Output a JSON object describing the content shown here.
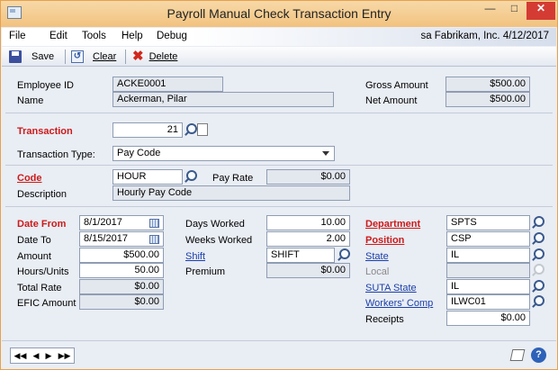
{
  "window": {
    "title": "Payroll Manual Check Transaction Entry"
  },
  "menu": {
    "items": [
      "File",
      "Edit",
      "Tools",
      "Help",
      "Debug"
    ],
    "company_info": "sa  Fabrikam, Inc.  4/12/2017"
  },
  "toolbar": {
    "save": "Save",
    "clear": "Clear",
    "delete": "Delete"
  },
  "employee": {
    "id_label": "Employee ID",
    "id_value": "ACKE0001",
    "name_label": "Name",
    "name_value": "Ackerman, Pilar"
  },
  "totals": {
    "gross_label": "Gross Amount",
    "gross_value": "$500.00",
    "net_label": "Net Amount",
    "net_value": "$500.00"
  },
  "transaction": {
    "label": "Transaction",
    "value": "21",
    "type_label": "Transaction Type:",
    "type_value": "Pay Code"
  },
  "code": {
    "label": "Code",
    "value": "HOUR",
    "pay_rate_label": "Pay Rate",
    "pay_rate_value": "$0.00",
    "description_label": "Description",
    "description_value": "Hourly Pay Code"
  },
  "left": {
    "date_from_label": "Date From",
    "date_from": "8/1/2017",
    "date_to_label": "Date To",
    "date_to": "8/15/2017",
    "amount_label": "Amount",
    "amount": "$500.00",
    "hours_label": "Hours/Units",
    "hours": "50.00",
    "total_rate_label": "Total Rate",
    "total_rate": "$0.00",
    "efic_label": "EFIC Amount",
    "efic": "$0.00"
  },
  "middle": {
    "days_label": "Days Worked",
    "days": "10.00",
    "weeks_label": "Weeks Worked",
    "weeks": "2.00",
    "shift_label": "Shift",
    "shift": "SHIFT",
    "premium_label": "Premium",
    "premium": "$0.00"
  },
  "right": {
    "department_label": "Department",
    "department": "SPTS",
    "position_label": "Position",
    "position": "CSP",
    "state_label": "State",
    "state": "IL",
    "local_label": "Local",
    "local": "",
    "suta_label": "SUTA State",
    "suta": "IL",
    "workers_comp_label": "Workers' Comp",
    "workers_comp": "ILWC01",
    "receipts_label": "Receipts",
    "receipts": "$0.00"
  },
  "colors": {
    "required": "#cc1a1a",
    "link": "#1a3fa8",
    "titlebar": "#f2c27f",
    "close": "#d43b33"
  }
}
